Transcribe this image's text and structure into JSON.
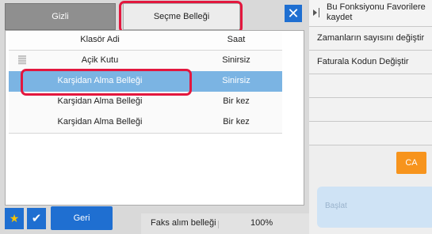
{
  "tabs": {
    "gizli_label": "Gizli",
    "secme_label": "Seçme Belleği"
  },
  "close_label": "✕",
  "columns": {
    "name_label": "Klasör Adi",
    "value_label": "Saat"
  },
  "rows": [
    {
      "name": "Açik Kutu",
      "value": "Sinirsiz",
      "selected": false
    },
    {
      "name": "Karşidan Alma Belleği",
      "value": "Sinirsiz",
      "selected": true
    },
    {
      "name": "Karşidan Alma Belleği",
      "value": "Bir kez",
      "selected": false
    },
    {
      "name": "Karşidan Alma Belleği",
      "value": "Bir kez",
      "selected": false
    }
  ],
  "right_panel": {
    "fn_header": "Bu Fonksiyonu Favorilere kaydet",
    "items": [
      "Zamanların sayısını değiştir",
      "Faturala Kodun Değiştir",
      "",
      "",
      ""
    ],
    "ca_label": "CA",
    "start_label": "Başlat"
  },
  "bottom": {
    "star_icon": "★",
    "check_icon": "✔",
    "back_label": "Geri"
  },
  "status": {
    "text": "Faks alım belleği",
    "percent": "100%"
  },
  "colors": {
    "accent": "#1f6fd1",
    "highlight": "#e3173e",
    "selected_row": "#7bb4e3",
    "ca": "#f7941d"
  }
}
